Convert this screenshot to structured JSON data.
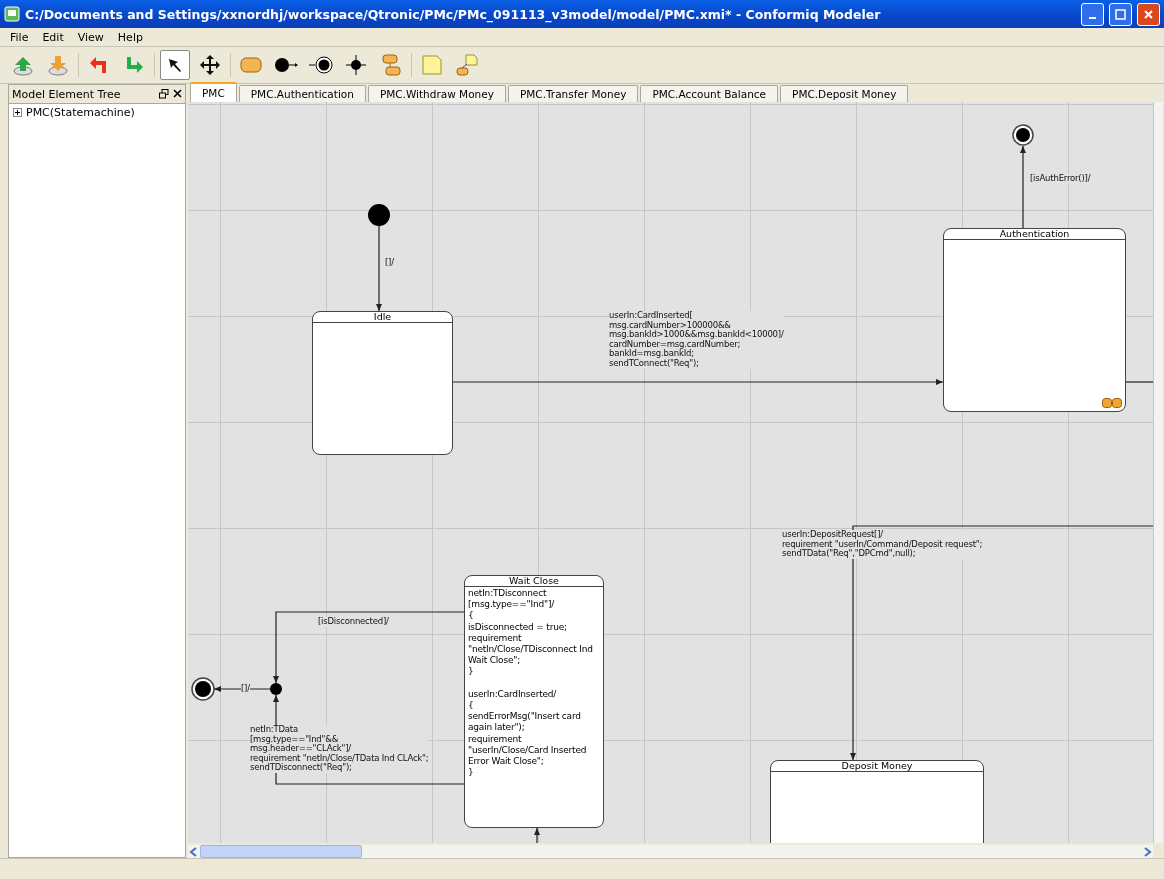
{
  "window": {
    "title": "C:/Documents and Settings/xxnordhj/workspace/Qtronic/PMc/PMc_091113_v3model/model/PMC.xmi* - Conformiq Modeler"
  },
  "menu": [
    "File",
    "Edit",
    "View",
    "Help"
  ],
  "toolbar": [
    {
      "kind": "upload",
      "selected": false
    },
    {
      "kind": "download",
      "selected": false
    },
    {
      "kind": "undo",
      "selected": false
    },
    {
      "kind": "redo",
      "selected": false
    },
    {
      "kind": "pointer",
      "selected": true
    },
    {
      "kind": "move",
      "selected": false
    },
    {
      "kind": "state",
      "selected": false
    },
    {
      "kind": "initial",
      "selected": false
    },
    {
      "kind": "final",
      "selected": false
    },
    {
      "kind": "junction",
      "selected": false
    },
    {
      "kind": "composite",
      "selected": false
    },
    {
      "kind": "note",
      "selected": false
    },
    {
      "kind": "notelink",
      "selected": false
    }
  ],
  "tree": {
    "title": "Model Element Tree",
    "items": [
      {
        "label": "PMC(Statemachine)",
        "expanded": false
      }
    ]
  },
  "tabs": [
    {
      "label": "PMC",
      "selected": true
    },
    {
      "label": "PMC.Authentication",
      "selected": false
    },
    {
      "label": "PMC.Withdraw Money",
      "selected": false
    },
    {
      "label": "PMC.Transfer Money",
      "selected": false
    },
    {
      "label": "PMC.Account Balance",
      "selected": false
    },
    {
      "label": "PMC.Deposit Money",
      "selected": false
    }
  ],
  "diagram": {
    "states": [
      {
        "name": "Idle",
        "submachine": false
      },
      {
        "name": "Authentication",
        "submachine": true
      },
      {
        "name": "Wait Close",
        "submachine": false,
        "body": "netIn:TDisconnect\n[msg.type==\"Ind\"]/\n{\nisDisconnected = true;\nrequirement\n\"netIn/Close/TDisconnect Ind\nWait Close\";\n}\n\nuserIn:CardInserted/\n{\nsendErrorMsg(\"Insert card\nagain later\");\nrequirement\n\"userIn/Close/Card Inserted\nError Wait Close\";\n}"
      },
      {
        "name": "Deposit Money",
        "submachine": false
      }
    ],
    "transitions": [
      {
        "label": "[]/"
      },
      {
        "label": "userIn:CardInserted[\nmsg.cardNumber>100000&&\nmsg.bankId>1000&&msg.bankId<10000]/\ncardNumber=msg.cardNumber;\nbankId=msg.bankId;\nsendTConnect(\"Req\");"
      },
      {
        "label": "[isAuthError()]/"
      },
      {
        "label": "userIn:DepositRequest[]/\nrequirement \"userIn/Command/Deposit request\";\nsendTData(\"Req\",\"DPCmd\",null);"
      },
      {
        "label": "[isDisconnected]/"
      },
      {
        "label": "netIn:TData\n[msg.type==\"Ind\"&&\nmsg.header==\"CLAck\"]/\nrequirement \"netIn/Close/TData Ind CLAck\";\nsendTDisconnect(\"Req\");"
      },
      {
        "label": "[]/"
      }
    ]
  }
}
